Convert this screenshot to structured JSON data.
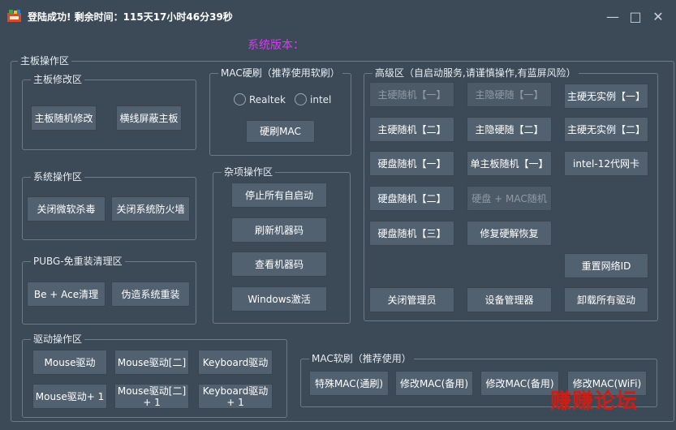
{
  "window": {
    "title": "登陆成功! 剩余时间：115天17小时46分39秒",
    "version": "系统版本："
  },
  "main_board": {
    "label": "主板操作区",
    "modify": {
      "label": "主板修改区",
      "buttons": [
        "主板随机修改",
        "横线屏蔽主板"
      ]
    },
    "system": {
      "label": "系统操作区",
      "buttons": [
        "关闭微软杀毒",
        "关闭系统防火墙"
      ]
    },
    "pubg": {
      "label": "PUBG-免重装清理区",
      "buttons": [
        "Be + Ace清理",
        "伪造系统重装"
      ]
    }
  },
  "mac_hard": {
    "label": "MAC硬刷（推荐使用软刷）",
    "radio1": "Realtek",
    "radio2": "intel",
    "button": "硬刷MAC"
  },
  "misc": {
    "label": "杂项操作区",
    "buttons": [
      "停止所有自启动",
      "刷新机器码",
      "查看机器码",
      "Windows激活"
    ]
  },
  "advanced": {
    "label": "高级区（自启动服务,请谨慎操作,有蓝屏风险）",
    "col1": [
      "主硬随机【一】",
      "主硬随机【二】",
      "硬盘随机【一】",
      "硬盘随机【二】",
      "硬盘随机【三】"
    ],
    "col2": [
      "主隐硬随【一】",
      "主隐硬随【二】",
      "单主板随机【一】",
      "硬盘 + MAC随机",
      "修复硬解恢复"
    ],
    "col3": [
      "主硬无实例【一】",
      "主硬无实例【二】",
      "intel-12代网卡"
    ],
    "reset_network": "重置网络ID",
    "bottom": [
      "关闭管理员",
      "设备管理器",
      "卸载所有驱动"
    ]
  },
  "driver": {
    "label": "驱动操作区",
    "buttons": [
      "Mouse驱动",
      "Mouse驱动[二]",
      "Keyboard驱动",
      "Mouse驱动+ 1",
      "Mouse驱动[二]\n+ 1",
      "Keyboard驱动\n+ 1"
    ]
  },
  "mac_soft": {
    "label": "MAC软刷（推荐使用）",
    "buttons": [
      "特殊MAC(通刷)",
      "修改MAC(备用)",
      "修改MAC(备用)",
      "修改MAC(WiFi)"
    ]
  },
  "watermark": "赚赚论坛",
  "colors": {
    "background": "#3c4a57",
    "button": "#526170",
    "version_text": "#d23cf0",
    "watermark": "#cc1e14"
  }
}
